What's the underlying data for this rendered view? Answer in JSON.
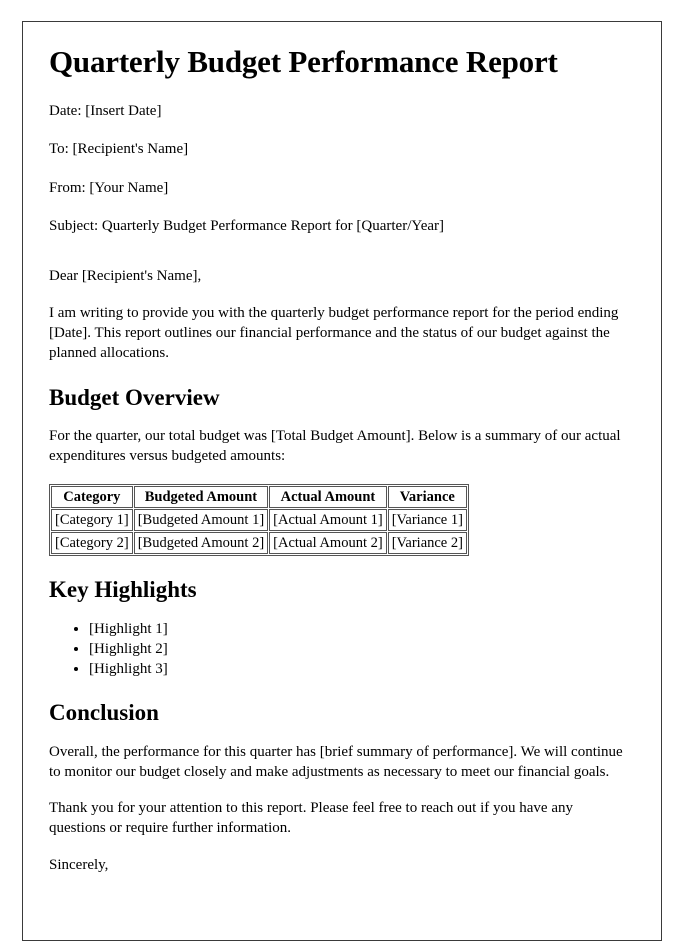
{
  "document": {
    "title": "Quarterly Budget Performance Report",
    "meta": [
      "Date: [Insert Date]",
      "To: [Recipient's Name]",
      "From: [Your Name]",
      "Subject: Quarterly Budget Performance Report for [Quarter/Year]"
    ],
    "salutation": "Dear [Recipient's Name],",
    "intro_paragraph": "I am writing to provide you with the quarterly budget performance report for the period ending [Date]. This report outlines our financial performance and the status of our budget against the planned allocations.",
    "sections": {
      "budget_overview": {
        "heading": "Budget Overview",
        "paragraph": "For the quarter, our total budget was [Total Budget Amount]. Below is a summary of our actual expenditures versus budgeted amounts:",
        "table": {
          "columns": [
            "Category",
            "Budgeted Amount",
            "Actual Amount",
            "Variance"
          ],
          "rows": [
            [
              "[Category 1]",
              "[Budgeted Amount 1]",
              "[Actual Amount 1]",
              "[Variance 1]"
            ],
            [
              "[Category 2]",
              "[Budgeted Amount 2]",
              "[Actual Amount 2]",
              "[Variance 2]"
            ]
          ]
        }
      },
      "key_highlights": {
        "heading": "Key Highlights",
        "items": [
          "[Highlight 1]",
          "[Highlight 2]",
          "[Highlight 3]"
        ]
      },
      "conclusion": {
        "heading": "Conclusion",
        "paragraph": "Overall, the performance for this quarter has [brief summary of performance]. We will continue to monitor our budget closely and make adjustments as necessary to meet our financial goals.",
        "thank_you": "Thank you for your attention to this report. Please feel free to reach out if you have any questions or require further information.",
        "closing": "Sincerely,"
      }
    }
  }
}
